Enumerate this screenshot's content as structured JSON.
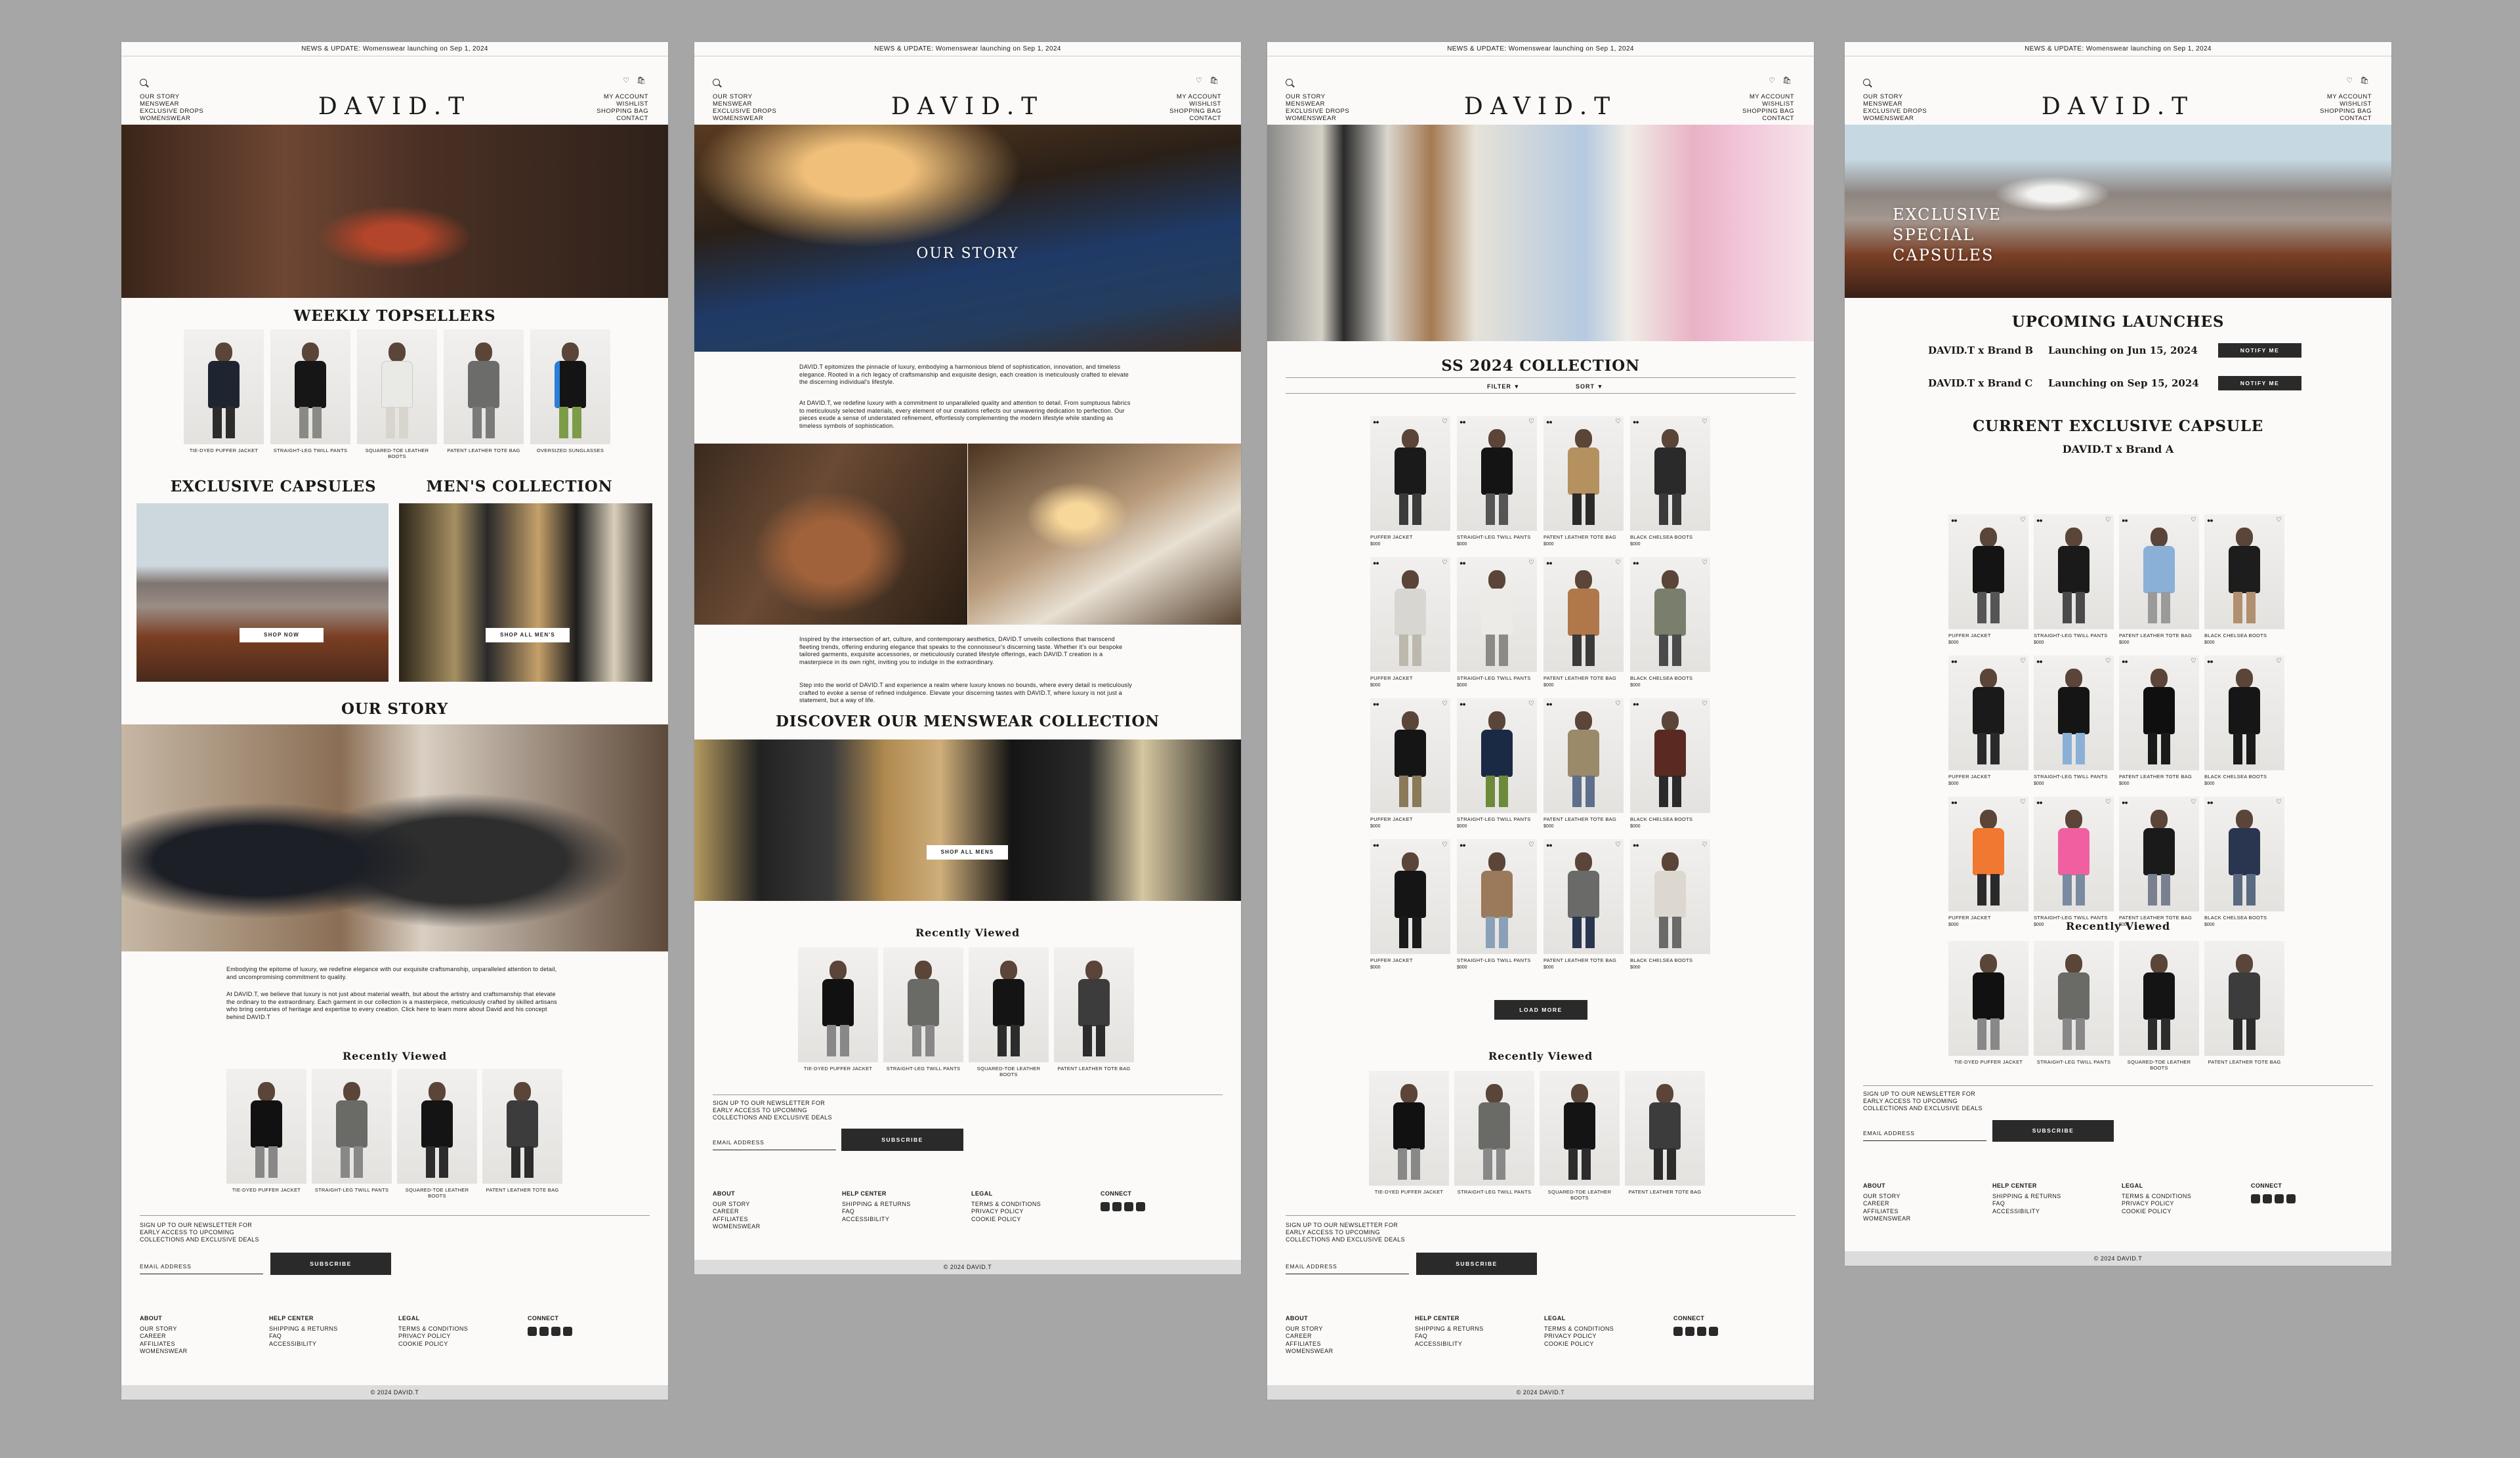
{
  "colors": {
    "background": "#a6a6a6",
    "page": "#fbfaf8",
    "button": "#2a2a2a",
    "footer_bar": "#dcdcdc"
  },
  "common": {
    "news": "NEWS & UPDATE: Womenswear launching on Sep 1, 2024",
    "logo": "DAVID.T",
    "header_icons": "♡ 🛍",
    "left_nav": [
      "OUR STORY",
      "MENSWEAR",
      "EXCLUSIVE DROPS",
      "WOMENSWEAR"
    ],
    "right_nav": [
      "MY ACCOUNT",
      "WISHLIST",
      "SHOPPING BAG",
      "CONTACT"
    ],
    "recently_viewed": "Recently Viewed",
    "newsletter": "SIGN UP TO OUR NEWSLETTER FOR EARLY ACCESS TO UPCOMING COLLECTIONS AND EXCLUSIVE DEALS",
    "email_placeholder": "EMAIL ADDRESS",
    "subscribe": "SUBSCRIBE",
    "footer": {
      "about": {
        "title": "ABOUT",
        "items": [
          "OUR STORY",
          "CAREER",
          "AFFILIATES",
          "WOMENSWEAR"
        ]
      },
      "help": {
        "title": "HELP CENTER",
        "items": [
          "SHIPPING & RETURNS",
          "FAQ",
          "ACCESSIBILITY"
        ]
      },
      "legal": {
        "title": "LEGAL",
        "items": [
          "TERMS & CONDITIONS",
          "PRIVACY POLICY",
          "COOKIE POLICY"
        ]
      },
      "connect": {
        "title": "CONNECT"
      }
    },
    "copyright": "© 2024 DAVID.T",
    "recent_items": [
      "TIE-DYED PUFFER JACKET",
      "STRAIGHT-LEG TWILL PANTS",
      "SQUARED-TOE LEATHER BOOTS",
      "PATENT LEATHER TOTE BAG"
    ],
    "price": "$000",
    "tags": "●●",
    "heart": "♡"
  },
  "page1": {
    "topsellers_title": "WEEKLY TOPSELLERS",
    "topsellers": [
      "TIE-DYED PUFFER JACKET",
      "STRAIGHT-LEG TWILL PANTS",
      "SQUARED-TOE LEATHER BOOTS",
      "PATENT LEATHER TOTE BAG",
      "OVERSIZED SUNGLASSES"
    ],
    "capsules_title": "EXCLUSIVE CAPSULES",
    "mens_title": "MEN'S COLLECTION",
    "shop_now": "SHOP NOW",
    "shop_all_mens": "SHOP ALL MEN'S",
    "story_title": "OUR STORY",
    "story_p1": "Embodying the epitome of luxury, we redefine elegance with our exquisite craftsmanship, unparalleled attention to detail, and uncompromising commitment to quality.",
    "story_p2": "At DAVID.T, we believe that luxury is not just about material wealth, but about the artistry and craftsmanship that elevate the ordinary to the extraordinary. Each garment in our collection is a masterpiece, meticulously crafted by skilled artisans who bring centuries of heritage and expertise to every creation. Click here to learn more about David and his concept behind DAVID.T"
  },
  "page2": {
    "hero": "OUR STORY",
    "p1": "DAVID.T epitomizes the pinnacle of luxury, embodying a harmonious blend of sophistication, innovation, and timeless elegance. Rooted in a rich legacy of craftsmanship and exquisite design, each creation is meticulously crafted to elevate the discerning individual's lifestyle.",
    "p2": "At DAVID.T, we redefine luxury with a commitment to unparalleled quality and attention to detail. From sumptuous fabrics to meticulously selected materials, every element of our creations reflects our unwavering dedication to perfection. Our pieces exude a sense of understated refinement, effortlessly complementing the modern lifestyle while standing as timeless symbols of sophistication.",
    "p3": "Inspired by the intersection of art, culture, and contemporary aesthetics, DAVID.T unveils collections that transcend fleeting trends, offering enduring elegance that speaks to the connoisseur's discerning taste. Whether it's our bespoke tailored garments, exquisite accessories, or meticulously curated lifestyle offerings, each DAVID.T creation is a masterpiece in its own right, inviting you to indulge in the extraordinary.",
    "p4": "Step into the world of DAVID.T and experience a realm where luxury knows no bounds, where every detail is meticulously crafted to evoke a sense of refined indulgence. Elevate your discerning tastes with DAVID.T, where luxury is not just a statement, but a way of life.",
    "discover": "DISCOVER OUR MENSWEAR COLLECTION",
    "shop_all_mens": "SHOP ALL MENS"
  },
  "page3": {
    "title": "SS 2024 COLLECTION",
    "filter": "FILTER ▼",
    "sort": "SORT ▼",
    "row_items": [
      "PUFFER JACKET",
      "STRAIGHT-LEG TWILL PANTS",
      "PATENT LEATHER TOTE BAG",
      "BLACK CHELSEA BOOTS"
    ],
    "load_more": "LOAD MORE"
  },
  "page4": {
    "hero": [
      "EXCLUSIVE",
      "SPECIAL",
      "CAPSULES"
    ],
    "upcoming": "UPCOMING LAUNCHES",
    "launches": [
      {
        "name": "DAVID.T x Brand B",
        "date": "Launching on Jun 15, 2024"
      },
      {
        "name": "DAVID.T x Brand C",
        "date": "Launching on Sep 15, 2024"
      }
    ],
    "notify": "NOTIFY ME",
    "current": "CURRENT EXCLUSIVE CAPSULE",
    "brand": "DAVID.T x Brand A"
  }
}
